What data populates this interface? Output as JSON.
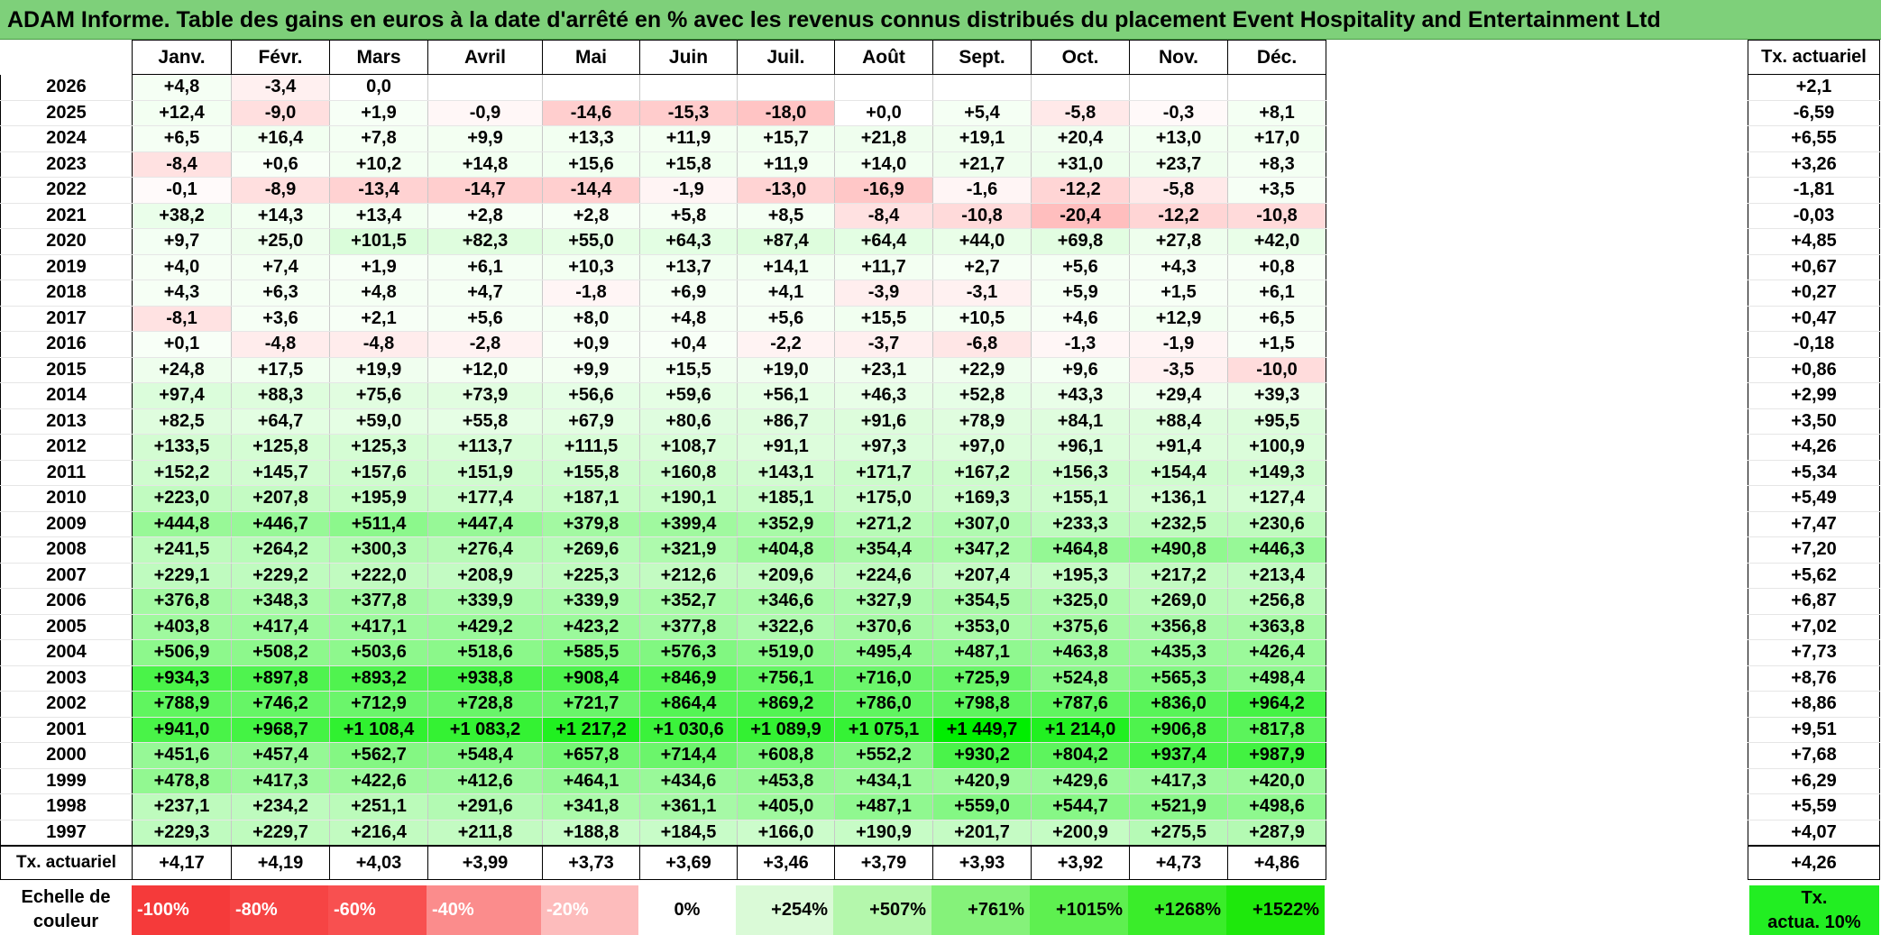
{
  "title": "ADAM Informe. Table des gains en euros à la date d'arrêté en % avec les revenus connus distribués du placement Event Hospitality and Entertainment Ltd",
  "months": [
    "Janv.",
    "Févr.",
    "Mars",
    "Avril",
    "Mai",
    "Juin",
    "Juil.",
    "Août",
    "Sept.",
    "Oct.",
    "Nov.",
    "Déc."
  ],
  "rate_header": "Tx. actuariel",
  "rows": [
    {
      "year": "2026",
      "values": [
        "+4,8",
        "-3,4",
        "0,0",
        "",
        "",
        "",
        "",
        "",
        "",
        "",
        "",
        ""
      ],
      "rate": "+2,1"
    },
    {
      "year": "2025",
      "values": [
        "+12,4",
        "-9,0",
        "+1,9",
        "-0,9",
        "-14,6",
        "-15,3",
        "-18,0",
        "+0,0",
        "+5,4",
        "-5,8",
        "-0,3",
        "+8,1"
      ],
      "rate": "-6,59"
    },
    {
      "year": "2024",
      "values": [
        "+6,5",
        "+16,4",
        "+7,8",
        "+9,9",
        "+13,3",
        "+11,9",
        "+15,7",
        "+21,8",
        "+19,1",
        "+20,4",
        "+13,0",
        "+17,0"
      ],
      "rate": "+6,55"
    },
    {
      "year": "2023",
      "values": [
        "-8,4",
        "+0,6",
        "+10,2",
        "+14,8",
        "+15,6",
        "+15,8",
        "+11,9",
        "+14,0",
        "+21,7",
        "+31,0",
        "+23,7",
        "+8,3"
      ],
      "rate": "+3,26"
    },
    {
      "year": "2022",
      "values": [
        "-0,1",
        "-8,9",
        "-13,4",
        "-14,7",
        "-14,4",
        "-1,9",
        "-13,0",
        "-16,9",
        "-1,6",
        "-12,2",
        "-5,8",
        "+3,5"
      ],
      "rate": "-1,81"
    },
    {
      "year": "2021",
      "values": [
        "+38,2",
        "+14,3",
        "+13,4",
        "+2,8",
        "+2,8",
        "+5,8",
        "+8,5",
        "-8,4",
        "-10,8",
        "-20,4",
        "-12,2",
        "-10,8"
      ],
      "rate": "-0,03"
    },
    {
      "year": "2020",
      "values": [
        "+9,7",
        "+25,0",
        "+101,5",
        "+82,3",
        "+55,0",
        "+64,3",
        "+87,4",
        "+64,4",
        "+44,0",
        "+69,8",
        "+27,8",
        "+42,0"
      ],
      "rate": "+4,85"
    },
    {
      "year": "2019",
      "values": [
        "+4,0",
        "+7,4",
        "+1,9",
        "+6,1",
        "+10,3",
        "+13,7",
        "+14,1",
        "+11,7",
        "+2,7",
        "+5,6",
        "+4,3",
        "+0,8"
      ],
      "rate": "+0,67"
    },
    {
      "year": "2018",
      "values": [
        "+4,3",
        "+6,3",
        "+4,8",
        "+4,7",
        "-1,8",
        "+6,9",
        "+4,1",
        "-3,9",
        "-3,1",
        "+5,9",
        "+1,5",
        "+6,1"
      ],
      "rate": "+0,27"
    },
    {
      "year": "2017",
      "values": [
        "-8,1",
        "+3,6",
        "+2,1",
        "+5,6",
        "+8,0",
        "+4,8",
        "+5,6",
        "+15,5",
        "+10,5",
        "+4,6",
        "+12,9",
        "+6,5"
      ],
      "rate": "+0,47"
    },
    {
      "year": "2016",
      "values": [
        "+0,1",
        "-4,8",
        "-4,8",
        "-2,8",
        "+0,9",
        "+0,4",
        "-2,2",
        "-3,7",
        "-6,8",
        "-1,3",
        "-1,9",
        "+1,5"
      ],
      "rate": "-0,18"
    },
    {
      "year": "2015",
      "values": [
        "+24,8",
        "+17,5",
        "+19,9",
        "+12,0",
        "+9,9",
        "+15,5",
        "+19,0",
        "+23,1",
        "+22,9",
        "+9,6",
        "-3,5",
        "-10,0"
      ],
      "rate": "+0,86"
    },
    {
      "year": "2014",
      "values": [
        "+97,4",
        "+88,3",
        "+75,6",
        "+73,9",
        "+56,6",
        "+59,6",
        "+56,1",
        "+46,3",
        "+52,8",
        "+43,3",
        "+29,4",
        "+39,3"
      ],
      "rate": "+2,99"
    },
    {
      "year": "2013",
      "values": [
        "+82,5",
        "+64,7",
        "+59,0",
        "+55,8",
        "+67,9",
        "+80,6",
        "+86,7",
        "+91,6",
        "+78,9",
        "+84,1",
        "+88,4",
        "+95,5"
      ],
      "rate": "+3,50"
    },
    {
      "year": "2012",
      "values": [
        "+133,5",
        "+125,8",
        "+125,3",
        "+113,7",
        "+111,5",
        "+108,7",
        "+91,1",
        "+97,3",
        "+97,0",
        "+96,1",
        "+91,4",
        "+100,9"
      ],
      "rate": "+4,26"
    },
    {
      "year": "2011",
      "values": [
        "+152,2",
        "+145,7",
        "+157,6",
        "+151,9",
        "+155,8",
        "+160,8",
        "+143,1",
        "+171,7",
        "+167,2",
        "+156,3",
        "+154,4",
        "+149,3"
      ],
      "rate": "+5,34"
    },
    {
      "year": "2010",
      "values": [
        "+223,0",
        "+207,8",
        "+195,9",
        "+177,4",
        "+187,1",
        "+190,1",
        "+185,1",
        "+175,0",
        "+169,3",
        "+155,1",
        "+136,1",
        "+127,4"
      ],
      "rate": "+5,49"
    },
    {
      "year": "2009",
      "values": [
        "+444,8",
        "+446,7",
        "+511,4",
        "+447,4",
        "+379,8",
        "+399,4",
        "+352,9",
        "+271,2",
        "+307,0",
        "+233,3",
        "+232,5",
        "+230,6"
      ],
      "rate": "+7,47"
    },
    {
      "year": "2008",
      "values": [
        "+241,5",
        "+264,2",
        "+300,3",
        "+276,4",
        "+269,6",
        "+321,9",
        "+404,8",
        "+354,4",
        "+347,2",
        "+464,8",
        "+490,8",
        "+446,3"
      ],
      "rate": "+7,20"
    },
    {
      "year": "2007",
      "values": [
        "+229,1",
        "+229,2",
        "+222,0",
        "+208,9",
        "+225,3",
        "+212,6",
        "+209,6",
        "+224,6",
        "+207,4",
        "+195,3",
        "+217,2",
        "+213,4"
      ],
      "rate": "+5,62"
    },
    {
      "year": "2006",
      "values": [
        "+376,8",
        "+348,3",
        "+377,8",
        "+339,9",
        "+339,9",
        "+352,7",
        "+346,6",
        "+327,9",
        "+354,5",
        "+325,0",
        "+269,0",
        "+256,8"
      ],
      "rate": "+6,87"
    },
    {
      "year": "2005",
      "values": [
        "+403,8",
        "+417,4",
        "+417,1",
        "+429,2",
        "+423,2",
        "+377,8",
        "+322,6",
        "+370,6",
        "+353,0",
        "+375,6",
        "+356,8",
        "+363,8"
      ],
      "rate": "+7,02"
    },
    {
      "year": "2004",
      "values": [
        "+506,9",
        "+508,2",
        "+503,6",
        "+518,6",
        "+585,5",
        "+576,3",
        "+519,0",
        "+495,4",
        "+487,1",
        "+463,8",
        "+435,3",
        "+426,4"
      ],
      "rate": "+7,73"
    },
    {
      "year": "2003",
      "values": [
        "+934,3",
        "+897,8",
        "+893,2",
        "+938,8",
        "+908,4",
        "+846,9",
        "+756,1",
        "+716,0",
        "+725,9",
        "+524,8",
        "+565,3",
        "+498,4"
      ],
      "rate": "+8,76"
    },
    {
      "year": "2002",
      "values": [
        "+788,9",
        "+746,2",
        "+712,9",
        "+728,8",
        "+721,7",
        "+864,4",
        "+869,2",
        "+786,0",
        "+798,8",
        "+787,6",
        "+836,0",
        "+964,2"
      ],
      "rate": "+8,86"
    },
    {
      "year": "2001",
      "values": [
        "+941,0",
        "+968,7",
        "+1 108,4",
        "+1 083,2",
        "+1 217,2",
        "+1 030,6",
        "+1 089,9",
        "+1 075,1",
        "+1 449,7",
        "+1 214,0",
        "+906,8",
        "+817,8"
      ],
      "rate": "+9,51"
    },
    {
      "year": "2000",
      "values": [
        "+451,6",
        "+457,4",
        "+562,7",
        "+548,4",
        "+657,8",
        "+714,4",
        "+608,8",
        "+552,2",
        "+930,2",
        "+804,2",
        "+937,4",
        "+987,9"
      ],
      "rate": "+7,68"
    },
    {
      "year": "1999",
      "values": [
        "+478,8",
        "+417,3",
        "+422,6",
        "+412,6",
        "+464,1",
        "+434,6",
        "+453,8",
        "+434,1",
        "+420,9",
        "+429,6",
        "+417,3",
        "+420,0"
      ],
      "rate": "+6,29"
    },
    {
      "year": "1998",
      "values": [
        "+237,1",
        "+234,2",
        "+251,1",
        "+291,6",
        "+341,8",
        "+361,1",
        "+405,0",
        "+487,1",
        "+559,0",
        "+544,7",
        "+521,9",
        "+498,6"
      ],
      "rate": "+5,59"
    },
    {
      "year": "1997",
      "values": [
        "+229,3",
        "+229,7",
        "+216,4",
        "+211,8",
        "+188,8",
        "+184,5",
        "+166,0",
        "+190,9",
        "+201,7",
        "+200,9",
        "+275,5",
        "+287,9"
      ],
      "rate": "+4,07"
    }
  ],
  "footer": {
    "label": "Tx. actuariel",
    "values": [
      "+4,17",
      "+4,19",
      "+4,03",
      "+3,99",
      "+3,73",
      "+3,69",
      "+3,46",
      "+3,79",
      "+3,93",
      "+3,92",
      "+4,73",
      "+4,86"
    ],
    "rate": "+4,26"
  },
  "scale": {
    "label_line1": "Echelle de",
    "label_line2": "couleur",
    "items": [
      {
        "label": "-100%",
        "color": "#f53a3a",
        "kind": "neg"
      },
      {
        "label": "-80%",
        "color": "#f64444",
        "kind": "neg"
      },
      {
        "label": "-60%",
        "color": "#f85050",
        "kind": "neg"
      },
      {
        "label": "-40%",
        "color": "#fb8c8c",
        "kind": "neg"
      },
      {
        "label": "-20%",
        "color": "#fdbcbc",
        "kind": "neg"
      },
      {
        "label": "0%",
        "color": "#ffffff",
        "kind": "zero"
      },
      {
        "label": "+254%",
        "color": "#dafad7",
        "kind": "pos"
      },
      {
        "label": "+507%",
        "color": "#b4f7ac",
        "kind": "pos"
      },
      {
        "label": "+761%",
        "color": "#85f27a",
        "kind": "pos"
      },
      {
        "label": "+1015%",
        "color": "#5ef050",
        "kind": "pos"
      },
      {
        "label": "+1268%",
        "color": "#3aed2a",
        "kind": "pos"
      },
      {
        "label": "+1522%",
        "color": "#1ee80c",
        "kind": "pos"
      }
    ],
    "actua_line1": "Tx.",
    "actua_line2": "actua. 10%"
  },
  "colors": {
    "title_bg": "#7ed07a",
    "positive_max": "#00ff00",
    "negative_max": "#f53a3a"
  }
}
